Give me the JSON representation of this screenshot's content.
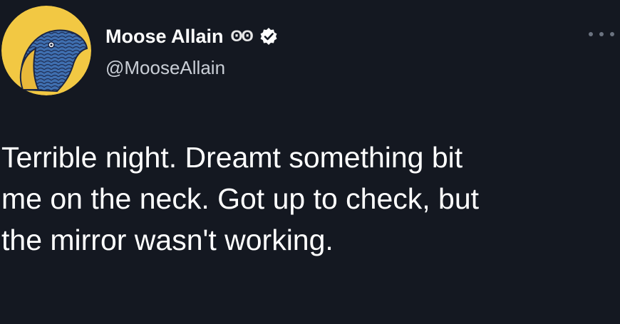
{
  "tweet": {
    "author": {
      "display_name": "Moose Allain",
      "emoji": "ʘʘ",
      "handle": "@MooseAllain",
      "avatar": "illustrated-bird-avatar-icon",
      "verified": true
    },
    "more_icon": "more-options-icon",
    "text_lines": [
      "Terrible night. Dreamt something bit",
      "me on the neck. Got up to check, but",
      "the mirror wasn't working."
    ]
  },
  "colors": {
    "background": "#141821",
    "text": "#ffffff",
    "handle": "#c9ced6",
    "avatar_bg": "#f2c843",
    "verified_badge": "#ffffff"
  }
}
